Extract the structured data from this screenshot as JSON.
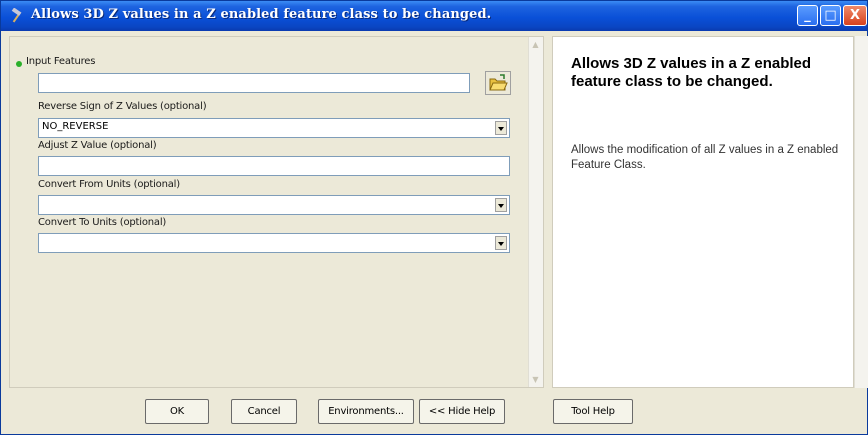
{
  "window": {
    "title": "Allows 3D Z values in a Z enabled feature class to be changed.",
    "title_icon": "hammer-icon",
    "minimize": "_",
    "maximize": "□",
    "close": "X"
  },
  "form": {
    "input_features": {
      "label": "Input Features",
      "value": "",
      "required_icon": "green-dot-icon",
      "browse_icon": "open-folder-icon"
    },
    "reverse_sign": {
      "label": "Reverse Sign of Z Values (optional)",
      "value": "NO_REVERSE"
    },
    "adjust_z": {
      "label": "Adjust Z Value (optional)",
      "value": ""
    },
    "convert_from": {
      "label": "Convert From Units (optional)",
      "value": ""
    },
    "convert_to": {
      "label": "Convert To Units (optional)",
      "value": ""
    }
  },
  "help": {
    "title": "Allows 3D Z values in a Z enabled feature class to be changed.",
    "body": "Allows the modification of all Z values in a Z enabled Feature Class."
  },
  "buttons": {
    "ok": "OK",
    "cancel": "Cancel",
    "environments": "Environments...",
    "hide_help": "<< Hide Help",
    "tool_help": "Tool Help"
  }
}
